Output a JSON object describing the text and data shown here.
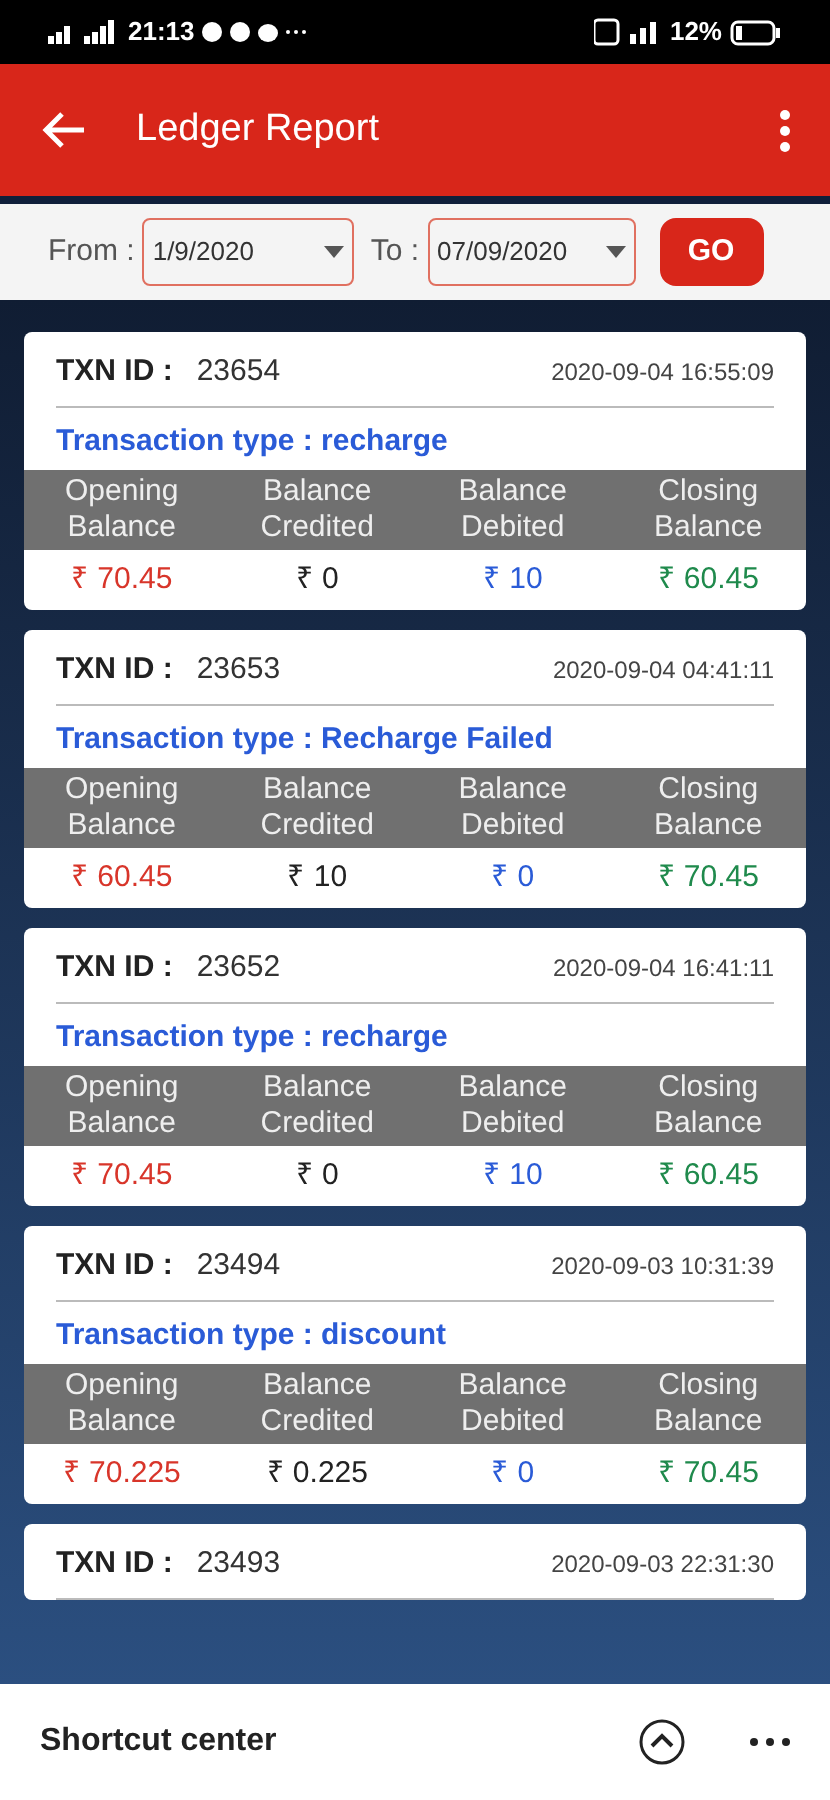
{
  "status_bar": {
    "time": "21:13",
    "battery": "12%"
  },
  "header": {
    "title": "Ledger Report"
  },
  "filter": {
    "from_label": "From :",
    "from_value": "1/9/2020",
    "to_label": "To :",
    "to_value": "07/09/2020",
    "go_button": "GO"
  },
  "transactions": [
    {
      "txn_label": "TXN ID :",
      "txn_id": "23654",
      "datetime": "2020-09-04 16:55:09",
      "type": "Transaction type : recharge",
      "columns": [
        "Opening Balance",
        "Balance Credited",
        "Balance Debited",
        "Closing Balance"
      ],
      "values": [
        "₹ 70.45",
        "₹ 0",
        "₹ 10",
        "₹ 60.45"
      ]
    },
    {
      "txn_label": "TXN ID :",
      "txn_id": "23653",
      "datetime": "2020-09-04 04:41:11",
      "type": "Transaction type : Recharge Failed",
      "columns": [
        "Opening Balance",
        "Balance Credited",
        "Balance Debited",
        "Closing Balance"
      ],
      "values": [
        "₹ 60.45",
        "₹ 10",
        "₹ 0",
        "₹ 70.45"
      ]
    },
    {
      "txn_label": "TXN ID :",
      "txn_id": "23652",
      "datetime": "2020-09-04 16:41:11",
      "type": "Transaction type : recharge",
      "columns": [
        "Opening Balance",
        "Balance Credited",
        "Balance Debited",
        "Closing Balance"
      ],
      "values": [
        "₹ 70.45",
        "₹ 0",
        "₹ 10",
        "₹ 60.45"
      ]
    },
    {
      "txn_label": "TXN ID :",
      "txn_id": "23494",
      "datetime": "2020-09-03 10:31:39",
      "type": "Transaction type : discount",
      "columns": [
        "Opening Balance",
        "Balance Credited",
        "Balance Debited",
        "Closing Balance"
      ],
      "values": [
        "₹ 70.225",
        "₹ 0.225",
        "₹ 0",
        "₹ 70.45"
      ]
    },
    {
      "txn_label": "TXN ID :",
      "txn_id": "23493",
      "datetime": "2020-09-03 22:31:30"
    }
  ],
  "shortcut_bar": {
    "title": "Shortcut center"
  }
}
